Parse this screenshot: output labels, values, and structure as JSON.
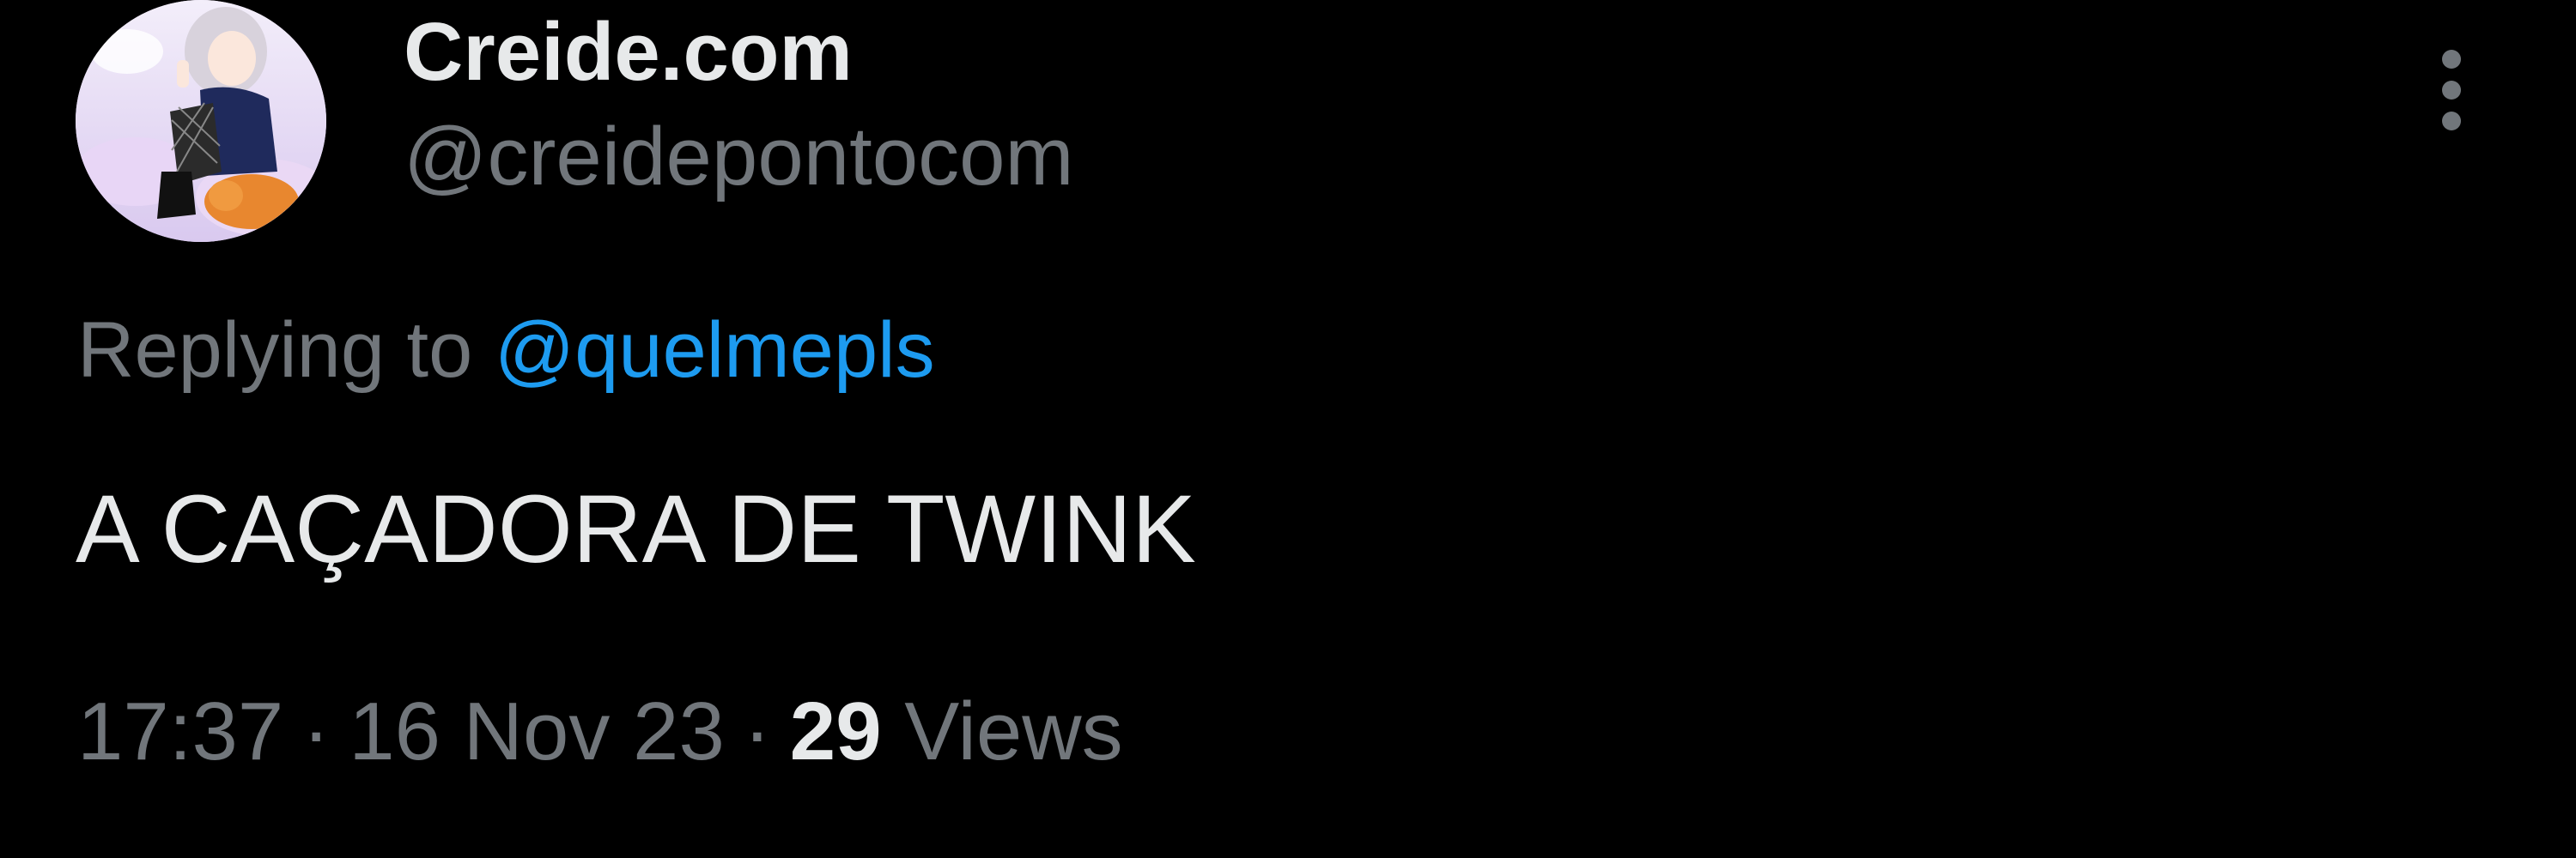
{
  "tweet": {
    "author": {
      "display_name": "Creide.com",
      "handle": "@creidepontocom",
      "avatar_icon": "illustrated-girl-avatar"
    },
    "reply": {
      "prefix": "Replying to ",
      "mention": "@quelmepls"
    },
    "text": "A CAÇADORA DE TWINK",
    "meta": {
      "time": "17:37",
      "separator": "·",
      "date": "16 Nov 23",
      "views_count": "29",
      "views_label": "Views"
    },
    "more_icon": "more-vertical-icon"
  },
  "colors": {
    "background": "#000000",
    "primary_text": "#e7e9ea",
    "secondary_text": "#71767b",
    "link": "#1d9bf0"
  }
}
